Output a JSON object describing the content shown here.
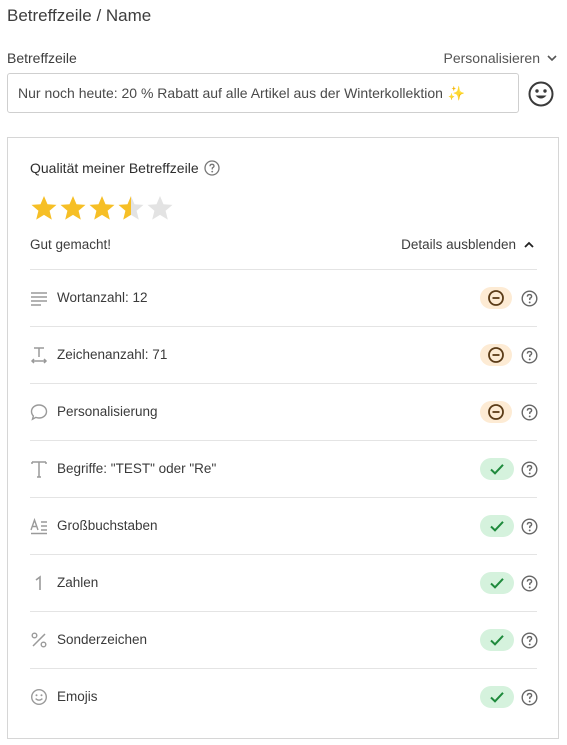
{
  "page": {
    "title": "Betreffzeile / Name"
  },
  "subject": {
    "label": "Betreffzeile",
    "personalize_label": "Personalisieren",
    "value": "Nur noch heute: 20 % Rabatt auf alle Artikel aus der Winterkollektion",
    "value_emoji": "✨"
  },
  "quality": {
    "title": "Qualität meiner Betreffzeile",
    "rating": 3.5,
    "rating_max": 5,
    "rating_text": "Gut gemacht!",
    "details_toggle": "Details ausblenden",
    "criteria": [
      {
        "label": "Wortanzahl: 12",
        "icon": "text-lines-icon",
        "status": "warning"
      },
      {
        "label": "Zeichenanzahl: 71",
        "icon": "text-width-icon",
        "status": "warning"
      },
      {
        "label": "Personalisierung",
        "icon": "speech-bubble-icon",
        "status": "warning"
      },
      {
        "label": "Begriffe: \"TEST\" oder \"Re\"",
        "icon": "letter-t-icon",
        "status": "ok"
      },
      {
        "label": "Großbuchstaben",
        "icon": "uppercase-icon",
        "status": "ok"
      },
      {
        "label": "Zahlen",
        "icon": "number-one-icon",
        "status": "ok"
      },
      {
        "label": "Sonderzeichen",
        "icon": "percent-icon",
        "status": "ok"
      },
      {
        "label": "Emojis",
        "icon": "smiley-icon",
        "status": "ok"
      }
    ]
  },
  "colors": {
    "star_filled": "#f6bf26",
    "star_empty": "#e3e3e3",
    "warning_bg": "#fdebd4",
    "warning_fg": "#5b3b16",
    "ok_bg": "#d5f2dd",
    "ok_fg": "#1e8a3c"
  }
}
